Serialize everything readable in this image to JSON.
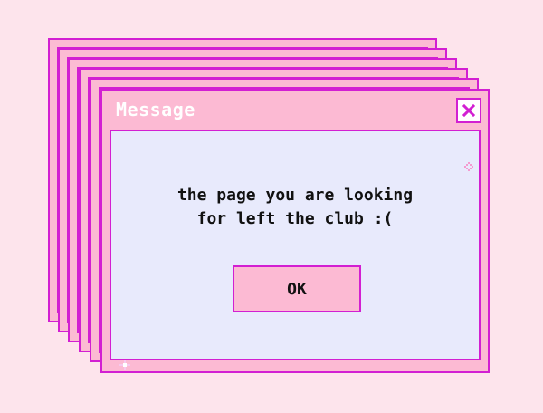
{
  "window": {
    "title": "Message",
    "close_icon": "close-icon"
  },
  "dialog": {
    "message_line1": "the page you are looking",
    "message_line2": "for left the club :(",
    "ok_label": "OK"
  },
  "decorations": {
    "sparkle_icon": "sparkle-icon"
  },
  "colors": {
    "background": "#fde4ec",
    "window_fill": "#fcbad3",
    "border": "#d21fd2",
    "content_fill": "#e8eafc",
    "text": "#111111",
    "title_text": "#ffffff"
  }
}
